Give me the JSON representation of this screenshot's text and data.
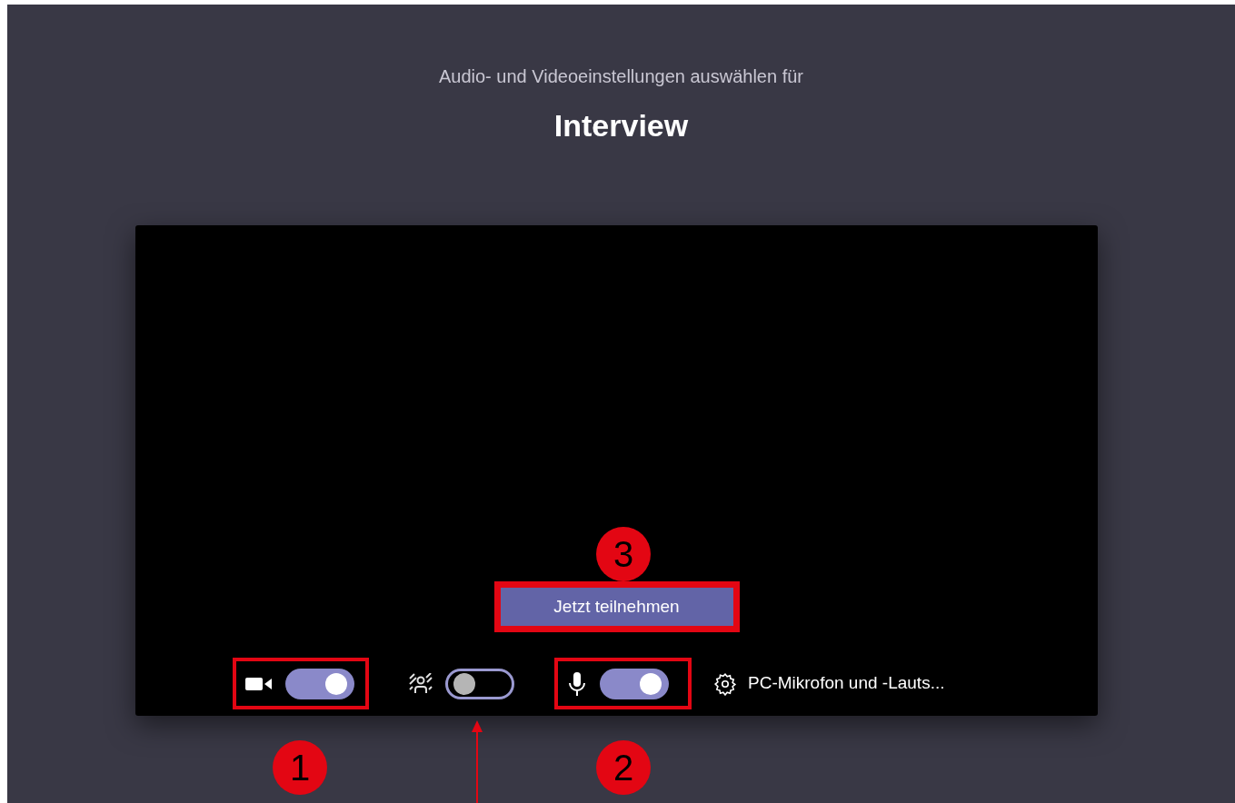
{
  "subtitle": "Audio- und Videoeinstellungen auswählen für",
  "title": "Interview",
  "join_button": {
    "label": "Jetzt teilnehmen",
    "highlighted": true
  },
  "controls": [
    {
      "kind": "camera",
      "on": true,
      "highlighted": true
    },
    {
      "kind": "background",
      "on": false,
      "highlighted": false
    },
    {
      "kind": "microphone",
      "on": true,
      "highlighted": true
    }
  ],
  "audio_device": "PC-Mikrofon und -Lauts...",
  "callouts": [
    {
      "label": "3"
    },
    {
      "label": "1"
    },
    {
      "label": "2"
    }
  ]
}
